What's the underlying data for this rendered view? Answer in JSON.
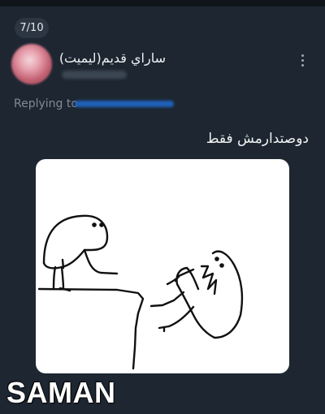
{
  "counter": "7/10",
  "tweet": {
    "display_name": "ساراي قديم(ليميت)",
    "replying_label": "Replying to",
    "text": "دوصتدارمش فقط"
  },
  "watermark": "SAMAN",
  "icons": {
    "more": "more-vertical-icon",
    "avatar": "avatar-image"
  },
  "colors": {
    "background": "#1d2631",
    "link": "#1f62bb",
    "text": "#f2f3f4",
    "muted": "#7f8b98"
  }
}
